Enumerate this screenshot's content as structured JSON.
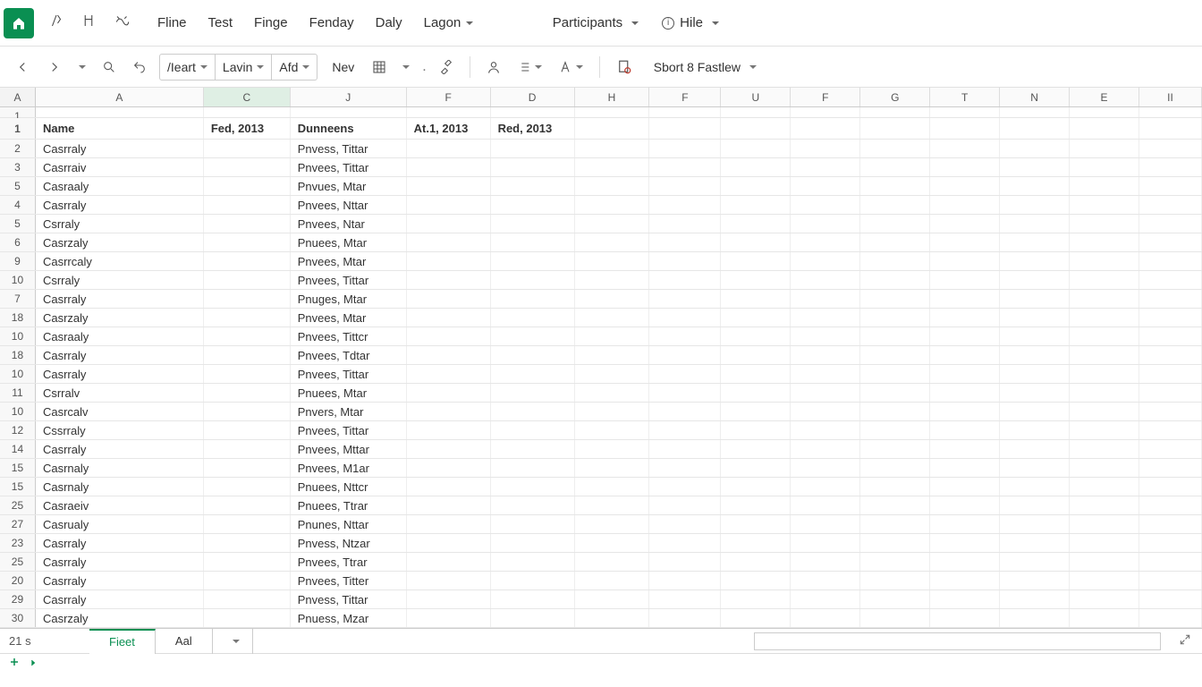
{
  "menubar": {
    "items": [
      "Fline",
      "Test",
      "Finge",
      "Fenday",
      "Daly",
      "Lagon"
    ],
    "right": {
      "participants": "Participants",
      "hile": "Hile"
    }
  },
  "toolbar": {
    "combo1": "/Ieart",
    "combo2": "Lavin",
    "combo3": "Afd",
    "nev": "Nev",
    "sort": "Sbort 8 Fastlew"
  },
  "columns": [
    {
      "l": "A",
      "w": 188
    },
    {
      "l": "C",
      "w": 97
    },
    {
      "l": "J",
      "w": 130
    },
    {
      "l": "F",
      "w": 94
    },
    {
      "l": "D",
      "w": 94
    },
    {
      "l": "H",
      "w": 84
    },
    {
      "l": "F",
      "w": 80
    },
    {
      "l": "U",
      "w": 78
    },
    {
      "l": "F",
      "w": 78
    },
    {
      "l": "G",
      "w": 78
    },
    {
      "l": "T",
      "w": 78
    },
    {
      "l": "N",
      "w": 78
    },
    {
      "l": "E",
      "w": 78
    },
    {
      "l": "II",
      "w": 70
    }
  ],
  "selected_col_index": 1,
  "header_row": {
    "num": "1",
    "name": "Name",
    "c": "Fed, 2013",
    "j": "Dunneens",
    "f": "At.1, 2013",
    "d": "Red, 2013"
  },
  "rows": [
    {
      "n": "1",
      "a": "",
      "j": ""
    },
    {
      "n": "2",
      "a": "Casrraly",
      "j": "Pnvess, Tittar"
    },
    {
      "n": "3",
      "a": "Casrraiv",
      "j": "Pnvees, Tittar"
    },
    {
      "n": "5",
      "a": "Casraaly",
      "j": "Pnvues, Mtar"
    },
    {
      "n": "4",
      "a": "Casrraly",
      "j": "Pnvees, Nttar"
    },
    {
      "n": "5",
      "a": "Csrraly",
      "j": "Pnvees, Ntar"
    },
    {
      "n": "6",
      "a": "Casrzaly",
      "j": "Pnuees, Mtar"
    },
    {
      "n": "9",
      "a": "Casrrcaly",
      "j": "Pnvees, Mtar"
    },
    {
      "n": "10",
      "a": "Csrraly",
      "j": "Pnvees, Tittar"
    },
    {
      "n": "7",
      "a": "Casrraly",
      "j": "Pnuges, Mtar"
    },
    {
      "n": "18",
      "a": "Casrzaly",
      "j": "Pnvees, Mtar"
    },
    {
      "n": "10",
      "a": "Casraaly",
      "j": "Pnvees, Tittcr"
    },
    {
      "n": "18",
      "a": "Casrraly",
      "j": "Pnvees, Tdtar"
    },
    {
      "n": "10",
      "a": "Casrraly",
      "j": "Pnvees, Tittar"
    },
    {
      "n": "11",
      "a": "Csrralv",
      "j": "Pnuees, Mtar"
    },
    {
      "n": "10",
      "a": "Casrcalv",
      "j": "Pnvers, Mtar"
    },
    {
      "n": "12",
      "a": "Cssrraly",
      "j": "Pnvees, Tittar"
    },
    {
      "n": "14",
      "a": "Casrraly",
      "j": "Pnvees, Mttar"
    },
    {
      "n": "15",
      "a": "Casrnaly",
      "j": "Pnvees, M1ar"
    },
    {
      "n": "15",
      "a": "Casrnaly",
      "j": "Pnuees, Nttcr"
    },
    {
      "n": "25",
      "a": "Casraeiv",
      "j": "Pnuees, Ttrar"
    },
    {
      "n": "27",
      "a": "Casrualy",
      "j": "Pnunes, Nttar"
    },
    {
      "n": "23",
      "a": "Casrraly",
      "j": "Pnvess, Ntzar"
    },
    {
      "n": "25",
      "a": "Cаsrraly",
      "j": "Pnvees, Ttrar"
    },
    {
      "n": "20",
      "a": "Casrraly",
      "j": "Pnvees, Titter"
    },
    {
      "n": "29",
      "a": "Casrraly",
      "j": "Pnvess, Tittar"
    },
    {
      "n": "30",
      "a": "Casrzaly",
      "j": "Pnuess, Mzar"
    }
  ],
  "footer": {
    "left": "21 s",
    "tab1": "Fieet",
    "tab2": "Aal"
  }
}
